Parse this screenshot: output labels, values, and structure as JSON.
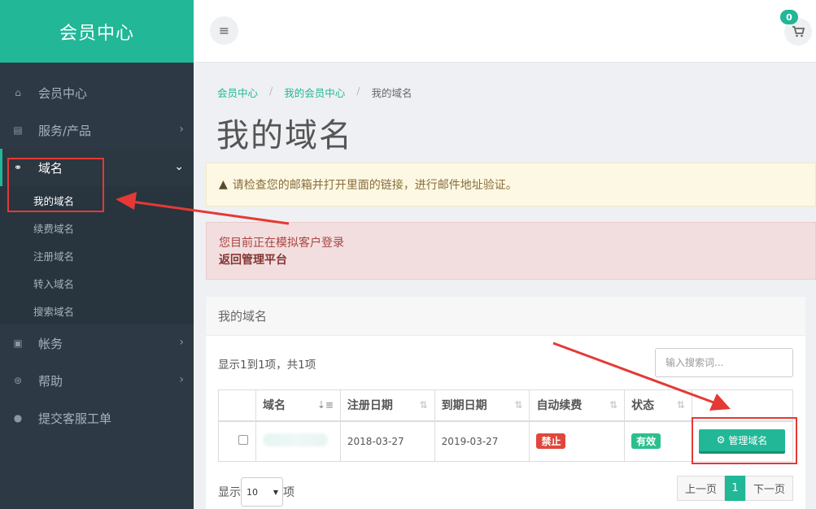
{
  "sidebar": {
    "brand": "会员中心",
    "items": [
      {
        "label": "会员中心",
        "icon": "home-icon",
        "glyph": "⌂"
      },
      {
        "label": "服务/产品",
        "icon": "server-icon",
        "glyph": "▤"
      },
      {
        "label": "域名",
        "icon": "link-icon",
        "glyph": "⚭"
      },
      {
        "label": "帐务",
        "icon": "money-icon",
        "glyph": "▣"
      },
      {
        "label": "帮助",
        "icon": "lifebuoy-icon",
        "glyph": "⊛"
      },
      {
        "label": "提交客服工单",
        "icon": "comment-icon",
        "glyph": "●"
      }
    ],
    "domain_sub": [
      "我的域名",
      "续费域名",
      "注册域名",
      "转入域名",
      "搜索域名"
    ]
  },
  "topbar": {
    "cart_count": "0"
  },
  "breadcrumb": [
    "会员中心",
    "我的会员中心",
    "我的域名"
  ],
  "page_title": "我的域名",
  "alert_warning": "请检查您的邮箱并打开里面的链接，进行邮件地址验证。",
  "alert_danger": {
    "text": "您目前正在模拟客户登录",
    "link": "返回管理平台"
  },
  "panel": {
    "title": "我的域名",
    "summary": "显示1到1项，共1项",
    "search_placeholder": "输入搜索词...",
    "columns": [
      "域名",
      "注册日期",
      "到期日期",
      "自动续费",
      "状态"
    ],
    "row": {
      "reg_date": "2018-03-27",
      "exp_date": "2019-03-27",
      "auto_renew": "禁止",
      "status": "有效",
      "action": "管理域名"
    },
    "length_label_pre": "显示",
    "length_value": "10",
    "length_label_post": "项",
    "pager": {
      "prev": "上一页",
      "page": "1",
      "next": "下一页"
    }
  },
  "colors": {
    "accent": "#21b797",
    "sidebar": "#2d3a45",
    "annotation": "#e53935"
  }
}
